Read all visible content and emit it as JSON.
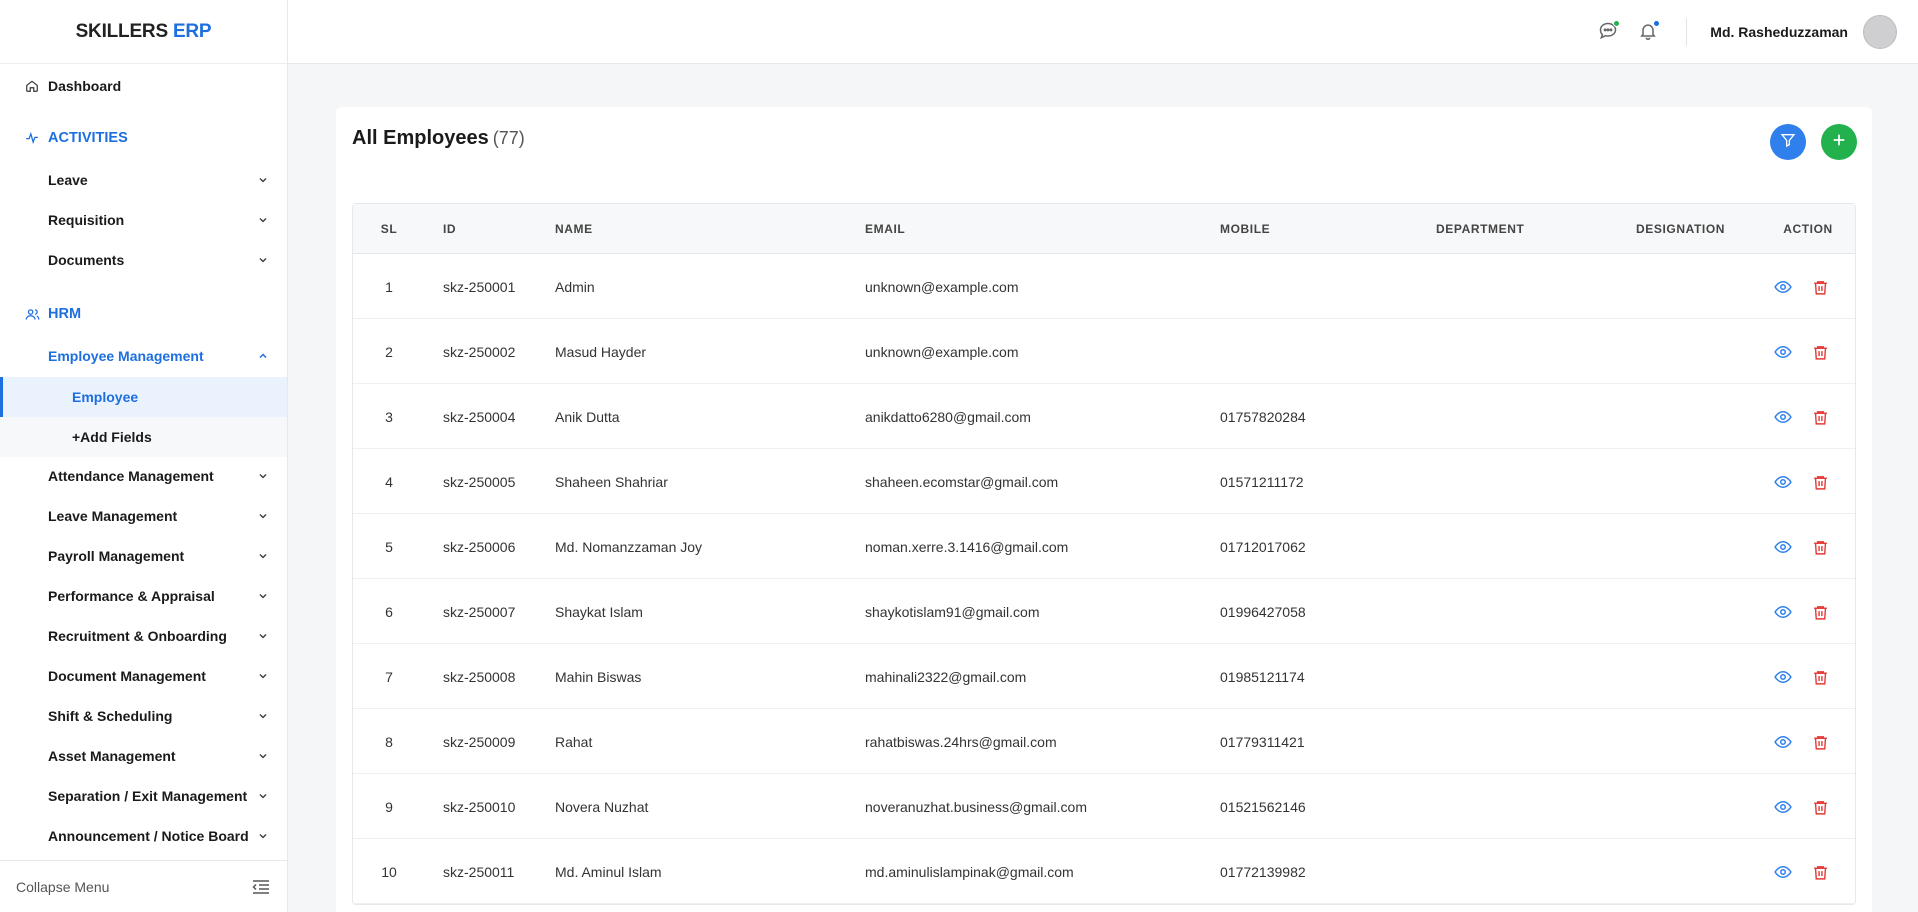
{
  "brand": {
    "name": "SKILLERS",
    "accent": "ERP"
  },
  "sidebar": {
    "dashboard": "Dashboard",
    "activities": {
      "title": "ACTIVITIES",
      "items": [
        "Leave",
        "Requisition",
        "Documents"
      ]
    },
    "hrm": {
      "title": "HRM",
      "employee_management": "Employee Management",
      "employee": "Employee",
      "add_fields": "+Add Fields",
      "items": [
        "Attendance Management",
        "Leave Management",
        "Payroll Management",
        "Performance & Appraisal",
        "Recruitment & Onboarding",
        "Document Management",
        "Shift & Scheduling",
        "Asset Management",
        "Separation / Exit Management",
        "Announcement / Notice Board"
      ]
    },
    "collapse_label": "Collapse Menu"
  },
  "header": {
    "user_name": "Md. Rasheduzzaman",
    "chat_dot_color": "#22b14c",
    "bell_dot_color": "#1d6fe0"
  },
  "page": {
    "title": "All Employees",
    "count": "(77)"
  },
  "table": {
    "columns": [
      "SL",
      "ID",
      "NAME",
      "EMAIL",
      "MOBILE",
      "DEPARTMENT",
      "DESIGNATION",
      "ACTION"
    ],
    "rows": [
      {
        "sl": "1",
        "id": "skz-250001",
        "name": "Admin",
        "email": "unknown@example.com",
        "mobile": "",
        "department": "",
        "designation": ""
      },
      {
        "sl": "2",
        "id": "skz-250002",
        "name": "Masud Hayder",
        "email": "unknown@example.com",
        "mobile": "",
        "department": "",
        "designation": ""
      },
      {
        "sl": "3",
        "id": "skz-250004",
        "name": "Anik Dutta",
        "email": "anikdatto6280@gmail.com",
        "mobile": "01757820284",
        "department": "",
        "designation": ""
      },
      {
        "sl": "4",
        "id": "skz-250005",
        "name": "Shaheen Shahriar",
        "email": "shaheen.ecomstar@gmail.com",
        "mobile": "01571211172",
        "department": "",
        "designation": ""
      },
      {
        "sl": "5",
        "id": "skz-250006",
        "name": "Md. Nomanzzaman Joy",
        "email": "noman.xerre.3.1416@gmail.com",
        "mobile": "01712017062",
        "department": "",
        "designation": ""
      },
      {
        "sl": "6",
        "id": "skz-250007",
        "name": "Shaykat Islam",
        "email": "shaykotislam91@gmail.com",
        "mobile": "01996427058",
        "department": "",
        "designation": ""
      },
      {
        "sl": "7",
        "id": "skz-250008",
        "name": "Mahin Biswas",
        "email": "mahinali2322@gmail.com",
        "mobile": "01985121174",
        "department": "",
        "designation": ""
      },
      {
        "sl": "8",
        "id": "skz-250009",
        "name": "Rahat",
        "email": "rahatbiswas.24hrs@gmail.com",
        "mobile": "01779311421",
        "department": "",
        "designation": ""
      },
      {
        "sl": "9",
        "id": "skz-250010",
        "name": "Novera Nuzhat",
        "email": "noveranuzhat.business@gmail.com",
        "mobile": "01521562146",
        "department": "",
        "designation": ""
      },
      {
        "sl": "10",
        "id": "skz-250011",
        "name": "Md. Aminul Islam",
        "email": "md.aminulislampinak@gmail.com",
        "mobile": "01772139982",
        "department": "",
        "designation": ""
      }
    ]
  },
  "icons": {
    "dashboard": "home-icon",
    "activities": "activity-icon",
    "hrm": "users-icon",
    "chat": "chat-icon",
    "bell": "bell-icon",
    "filter": "filter-icon",
    "add": "plus-icon",
    "view": "eye-icon",
    "delete": "trash-icon",
    "collapse": "collapse-menu-icon"
  },
  "colors": {
    "primary": "#1d6fe0",
    "filter_button": "#2f80ed",
    "add_button": "#22b14c",
    "danger": "#e53935"
  }
}
